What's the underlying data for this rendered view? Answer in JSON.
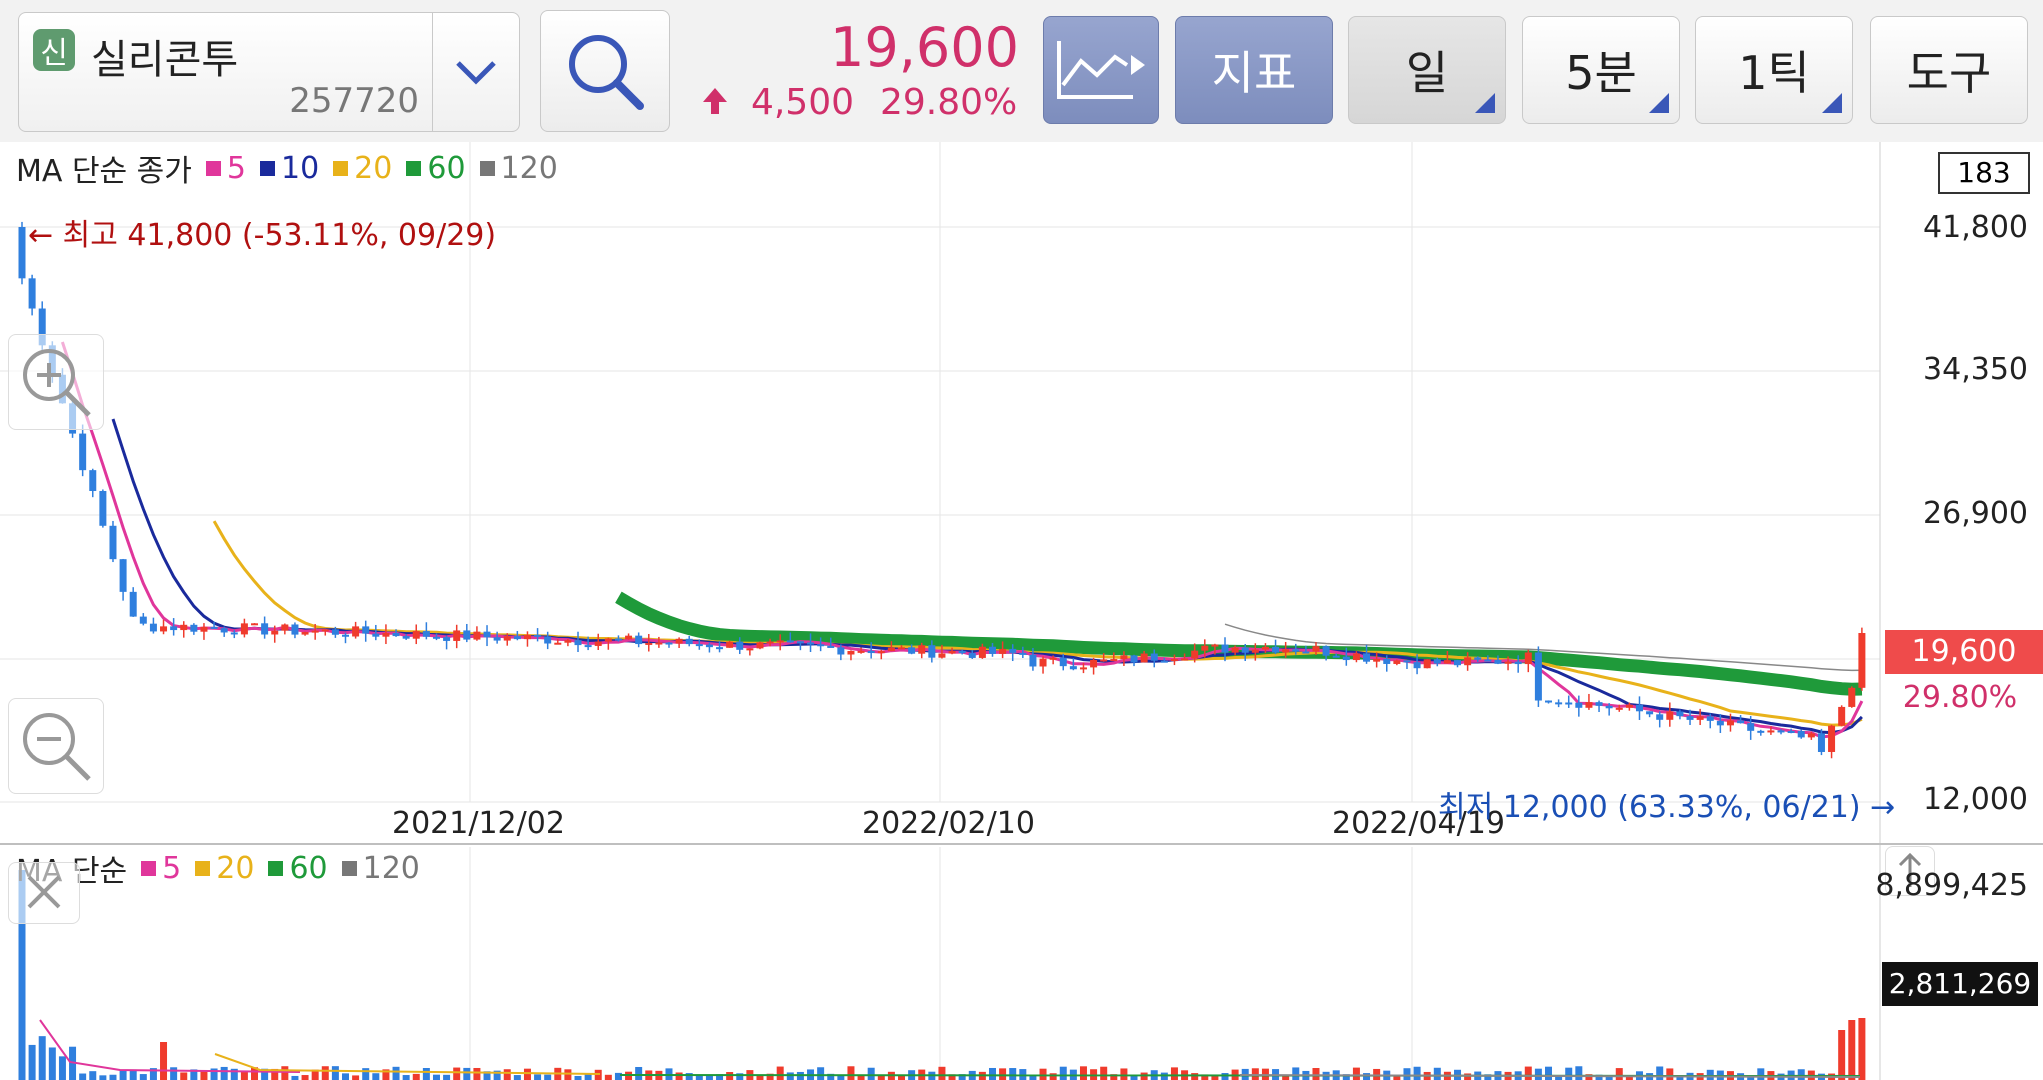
{
  "header": {
    "badge": "신",
    "stock_name": "실리콘투",
    "stock_code": "257720",
    "price": "19,600",
    "change": "4,500",
    "change_pct": "29.80%",
    "buttons": {
      "indicator": "지표",
      "day": "일",
      "minute": "5분",
      "tick": "1틱",
      "tools": "도구"
    }
  },
  "price_panel": {
    "legend_prefix": "MA 단순 종가",
    "legend_items": [
      {
        "label": "5",
        "color": "#e0369b"
      },
      {
        "label": "10",
        "color": "#1a2a9c"
      },
      {
        "label": "20",
        "color": "#e8b21a"
      },
      {
        "label": "60",
        "color": "#1f9a3a"
      },
      {
        "label": "120",
        "color": "#777777"
      }
    ],
    "count_box": "183",
    "y_labels": [
      "41,800",
      "34,350",
      "26,900",
      "12,000"
    ],
    "current_price_tag": "19,600",
    "current_pct_tag": "29.80%",
    "date_labels": [
      "2021/12/02",
      "2022/02/10",
      "2022/04/19"
    ],
    "high_annotation": "← 최고 41,800 (-53.11%, 09/29)",
    "low_annotation": "최저 12,000 (63.33%, 06/21) →"
  },
  "volume_panel": {
    "legend_prefix": "MA 단순",
    "legend_items": [
      {
        "label": "5",
        "color": "#e0369b"
      },
      {
        "label": "20",
        "color": "#e8b21a"
      },
      {
        "label": "60",
        "color": "#1f9a3a"
      },
      {
        "label": "120",
        "color": "#777777"
      }
    ],
    "y_top": "8,899,425",
    "current_volume_tag": "2,811,269"
  },
  "colors": {
    "up": "#ef3b2c",
    "down": "#2f7fde",
    "accent_red": "#d0306a"
  }
}
